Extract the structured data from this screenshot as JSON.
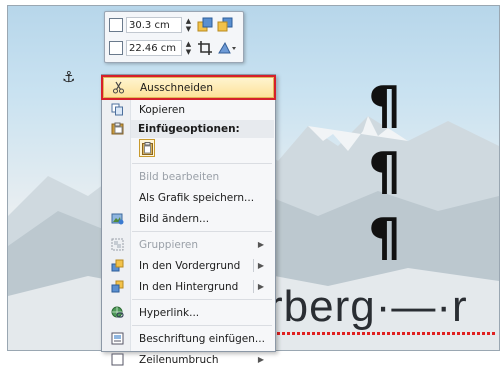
{
  "document": {
    "anchor_glyph": "⚓",
    "pilcrow": "¶",
    "big_text": "rberg·—·r"
  },
  "minibar": {
    "height_value": "30.3 cm",
    "width_value": "22.46 cm",
    "spin_up": "▲",
    "spin_down": "▼"
  },
  "context_menu": {
    "cut": "Ausschneiden",
    "copy": "Kopieren",
    "paste_header": "Einfügeoptionen:",
    "edit_image": "Bild bearbeiten",
    "save_as_graphic": "Als Grafik speichern...",
    "change_image": "Bild ändern...",
    "group": "Gruppieren",
    "bring_front": "In den Vordergrund",
    "send_back": "In den Hintergrund",
    "hyperlink": "Hyperlink...",
    "insert_caption": "Beschriftung einfügen...",
    "line_break": "Zeilenumbruch",
    "submenu_arrow": "▶"
  },
  "colors": {
    "highlight_border": "#d6202a",
    "highlight_fill": "#fde29a"
  }
}
